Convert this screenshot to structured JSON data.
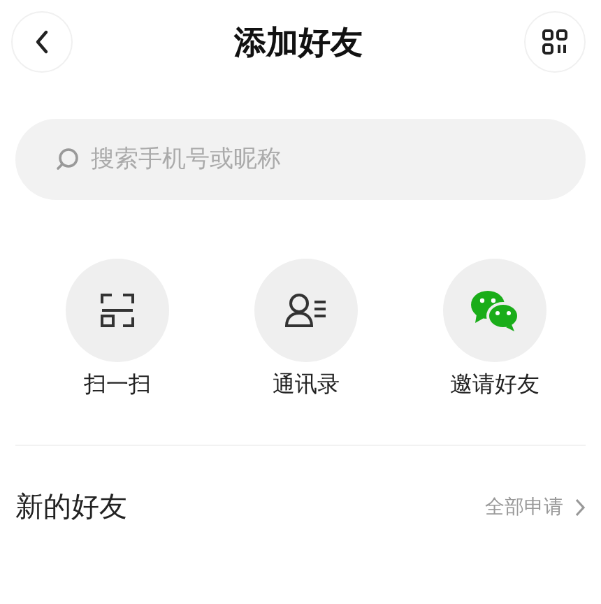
{
  "header": {
    "title": "添加好友"
  },
  "search": {
    "placeholder": "搜索手机号或昵称"
  },
  "actions": [
    {
      "kind": "scan",
      "label": "扫一扫"
    },
    {
      "kind": "contacts",
      "label": "通讯录"
    },
    {
      "kind": "wechat",
      "label": "邀请好友"
    }
  ],
  "section": {
    "title": "新的好友",
    "link": "全部申请"
  }
}
